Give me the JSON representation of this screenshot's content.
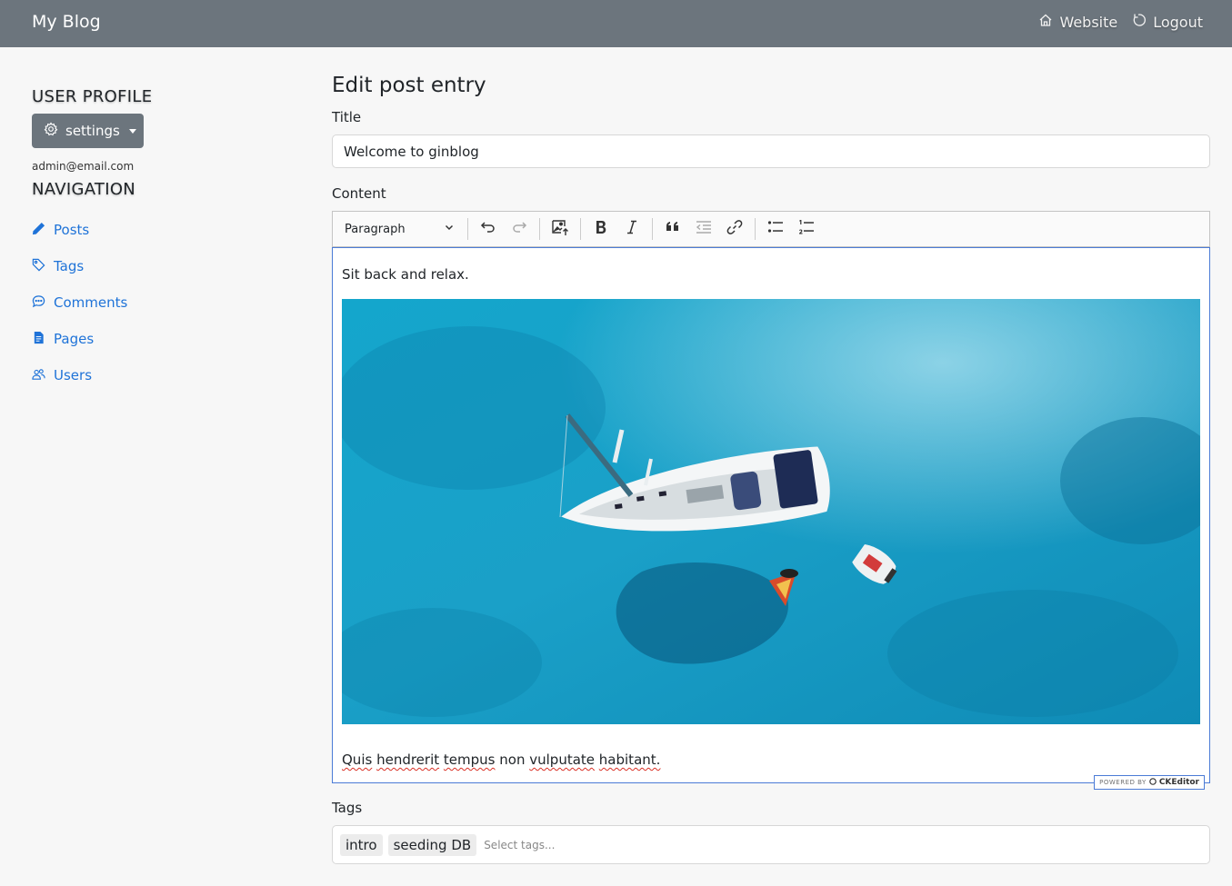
{
  "navbar": {
    "brand": "My Blog",
    "links": [
      {
        "label": "Website",
        "icon": "home-icon"
      },
      {
        "label": "Logout",
        "icon": "logout-icon"
      }
    ]
  },
  "sidebar": {
    "profile_heading": "USER PROFILE",
    "settings_label": "settings",
    "email": "admin@email.com",
    "navigation_heading": "NAVIGATION",
    "items": [
      {
        "label": "Posts",
        "icon": "pencil-icon"
      },
      {
        "label": "Tags",
        "icon": "tag-icon"
      },
      {
        "label": "Comments",
        "icon": "comment-icon"
      },
      {
        "label": "Pages",
        "icon": "page-icon"
      },
      {
        "label": "Users",
        "icon": "users-icon"
      }
    ]
  },
  "form": {
    "page_title": "Edit post entry",
    "title_label": "Title",
    "title_value": "Welcome to ginblog",
    "content_label": "Content",
    "tags_label": "Tags",
    "tags": [
      "intro",
      "seeding DB"
    ],
    "tags_placeholder": "Select tags..."
  },
  "editor": {
    "heading_select": "Paragraph",
    "paragraph_1": "Sit back and relax.",
    "paragraph_2_words": [
      "Quis",
      "hendrerit",
      "tempus",
      "non",
      "vulputate",
      "habitant."
    ],
    "powered_by": "POWERED BY",
    "powered_brand": "CKEditor",
    "image_alt": "sailboat in turquoise sea aerial photo",
    "toolbar_icons": [
      "undo-icon",
      "redo-icon",
      "insert-image-icon",
      "bold-icon",
      "italic-icon",
      "blockquote-icon",
      "outdent-icon",
      "link-icon",
      "bulleted-list-icon",
      "numbered-list-icon"
    ]
  },
  "colors": {
    "navbar": "#6c757d",
    "link": "#1f73d8",
    "editor_focus": "#4b7bd6",
    "sea": "#1aa3c9"
  }
}
